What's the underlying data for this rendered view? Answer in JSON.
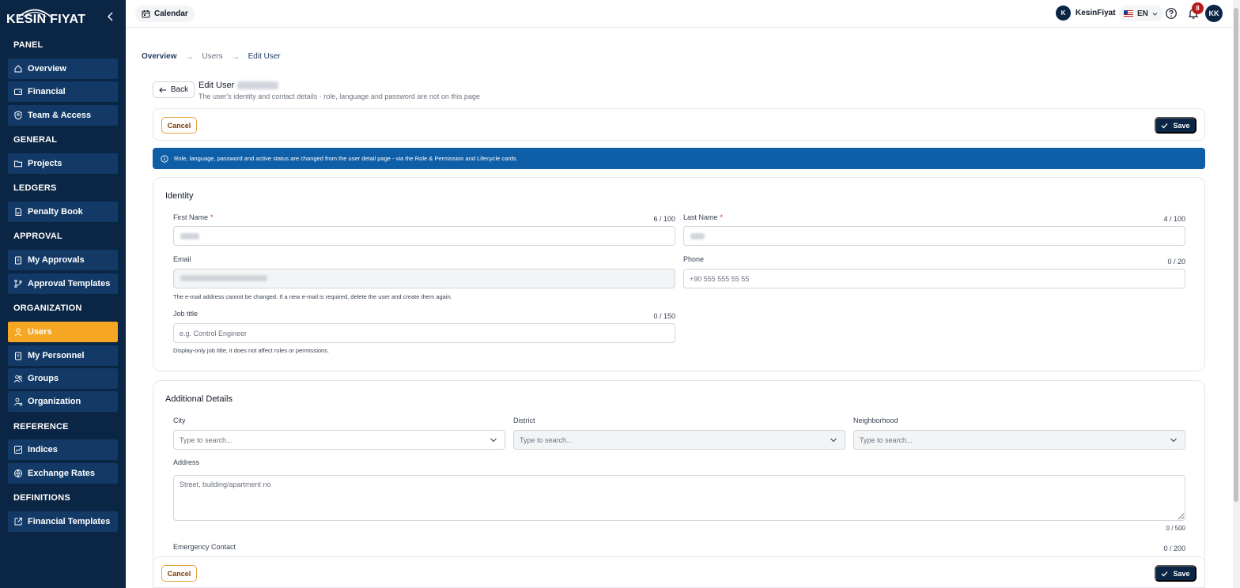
{
  "brand": {
    "logo_text": "KESIN FIYAT"
  },
  "sidebar": {
    "sections": [
      {
        "title": "PANEL"
      },
      {
        "title": "GENERAL"
      },
      {
        "title": "LEDGERS"
      },
      {
        "title": "APPROVAL"
      },
      {
        "title": "ORGANIZATION"
      },
      {
        "title": "REFERENCE"
      },
      {
        "title": "DEFINITIONS"
      }
    ],
    "items": [
      {
        "label": "Overview",
        "icon": "home-icon"
      },
      {
        "label": "Financial",
        "icon": "wallet-icon"
      },
      {
        "label": "Team & Access",
        "icon": "user-shield-icon"
      },
      {
        "label": "Projects",
        "icon": "folder-icon"
      },
      {
        "label": "Penalty Book",
        "icon": "file-icon"
      },
      {
        "label": "My Approvals",
        "icon": "clipboard-icon"
      },
      {
        "label": "Approval Templates",
        "icon": "branch-icon"
      },
      {
        "label": "Users",
        "icon": "user-icon",
        "active": true
      },
      {
        "label": "My Personnel",
        "icon": "clipboard-icon"
      },
      {
        "label": "Groups",
        "icon": "users-icon"
      },
      {
        "label": "Organization",
        "icon": "user-cog-icon"
      },
      {
        "label": "Indices",
        "icon": "chart-icon"
      },
      {
        "label": "Exchange Rates",
        "icon": "globe-icon"
      },
      {
        "label": "Financial Templates",
        "icon": "external-file-icon"
      }
    ]
  },
  "topbar": {
    "calendar_label": "Calendar",
    "user_initial": "K",
    "user_name": "KesinFiyat",
    "language": "EN",
    "notification_count": "8",
    "avatar_initials": "KK"
  },
  "breadcrumb": {
    "items": [
      "Overview",
      "Users",
      "Edit User"
    ]
  },
  "header": {
    "back_label": "Back",
    "title": "Edit User",
    "subtitle": "The user's identity and contact details · role, language and password are not on this page"
  },
  "actions": {
    "cancel_label": "Cancel",
    "save_label": "Save"
  },
  "info_banner": "Role, language, password and active status are changed from the user detail page - via the Role & Permission and Lifecycle cards.",
  "identity": {
    "title": "Identity",
    "first_name": {
      "label": "First Name",
      "counter": "6 / 100"
    },
    "last_name": {
      "label": "Last Name",
      "counter": "4 / 100"
    },
    "email": {
      "label": "Email",
      "help": "The e-mail address cannot be changed. If a new e-mail is required, delete the user and create them again."
    },
    "phone": {
      "label": "Phone",
      "counter": "0 / 20",
      "placeholder": "+90 555 555 55 55"
    },
    "job_title": {
      "label": "Job title",
      "counter": "0 / 150",
      "placeholder": "e.g. Control Engineer",
      "help": "Display-only job title; it does not affect roles or permissions."
    }
  },
  "additional": {
    "title": "Additional Details",
    "city": {
      "label": "City",
      "placeholder": "Type to search..."
    },
    "district": {
      "label": "District",
      "placeholder": "Type to search..."
    },
    "neighborhood": {
      "label": "Neighborhood",
      "placeholder": "Type to search..."
    },
    "address": {
      "label": "Address",
      "placeholder": "Street, building/apartment no",
      "counter": "0 / 500"
    },
    "emergency": {
      "label": "Emergency Contact",
      "counter": "0 / 200"
    }
  },
  "colors": {
    "sidebar": "#0b2545",
    "nav_item": "#133a66",
    "active": "#f5a623",
    "banner": "#0f5ea8",
    "primary_button": "#0b2545"
  }
}
